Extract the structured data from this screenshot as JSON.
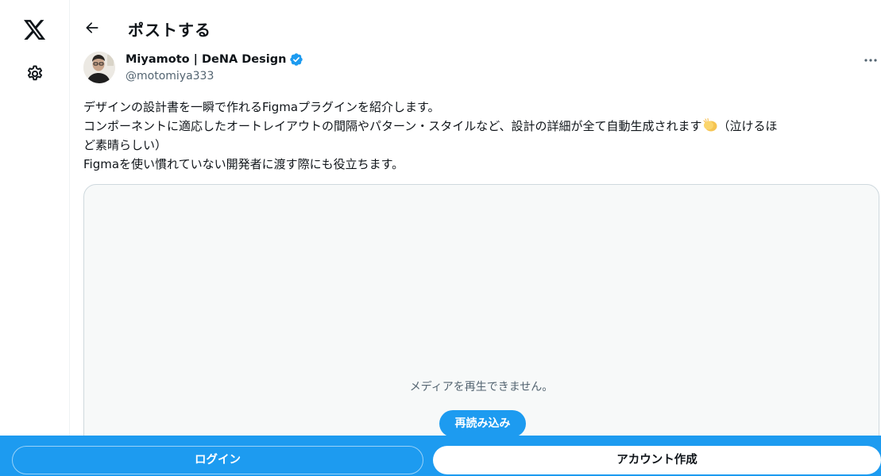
{
  "rail": {
    "logo_icon": "x-logo-icon",
    "settings_icon": "gear-icon"
  },
  "header": {
    "back_icon": "arrow-left-icon",
    "title": "ポストする"
  },
  "author": {
    "name": "Miyamoto | DeNA Design",
    "handle": "@motomiya333",
    "verified_icon": "verified-badge-icon",
    "verified_color": "#1d9bf0"
  },
  "tweet": {
    "line1": "デザインの設計書を一瞬で作れるFigmaプラグインを紹介します。",
    "line2": "コンポーネントに適応したオートレイアウトの間隔やパターン・スタイルなど、設計の詳細が全て自動生成されます",
    "line2_tail": "（泣けるほ",
    "line3": "ど素晴らしい）",
    "line4": "Figmaを使い慣れていない開発者に渡す際にも役立ちます。",
    "emoji_icon": "clapping-hands-icon"
  },
  "media": {
    "error_message": "メディアを再生できません。",
    "reload_label": "再読み込み"
  },
  "bottom_bar": {
    "login_label": "ログイン",
    "signup_label": "アカウント作成",
    "bar_color": "#1d9bf0"
  }
}
